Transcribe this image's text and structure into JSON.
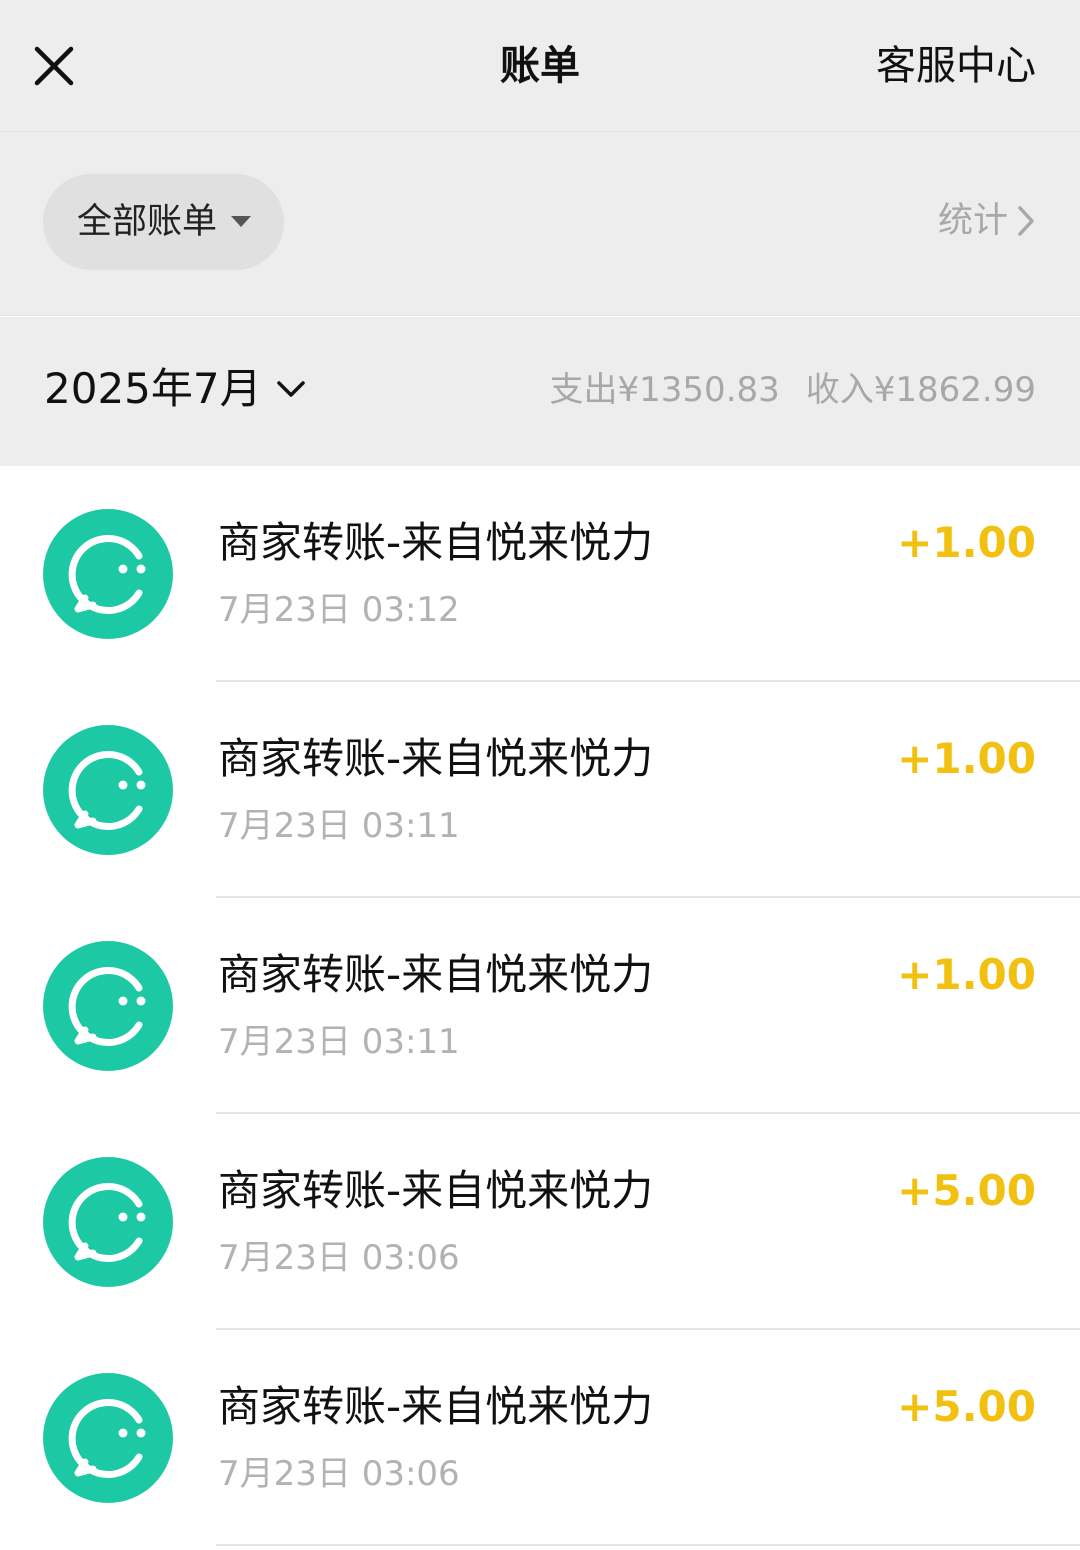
{
  "header": {
    "title": "账单",
    "service_label": "客服中心"
  },
  "filter": {
    "selected": "全部账单",
    "stats_label": "统计"
  },
  "month": {
    "label": "2025年7月",
    "expense": "支出¥1350.83",
    "income": "收入¥1862.99"
  },
  "colors": {
    "income_amount": "#f2c010",
    "avatar_bg": "#1dc9a4"
  },
  "transactions": [
    {
      "title": "商家转账-来自悦来悦力",
      "time": "7月23日 03:12",
      "amount": "+1.00",
      "icon": "smile-chat-icon"
    },
    {
      "title": "商家转账-来自悦来悦力",
      "time": "7月23日 03:11",
      "amount": "+1.00",
      "icon": "smile-chat-icon"
    },
    {
      "title": "商家转账-来自悦来悦力",
      "time": "7月23日 03:11",
      "amount": "+1.00",
      "icon": "smile-chat-icon"
    },
    {
      "title": "商家转账-来自悦来悦力",
      "time": "7月23日 03:06",
      "amount": "+5.00",
      "icon": "smile-chat-icon"
    },
    {
      "title": "商家转账-来自悦来悦力",
      "time": "7月23日 03:06",
      "amount": "+5.00",
      "icon": "smile-chat-icon"
    }
  ]
}
